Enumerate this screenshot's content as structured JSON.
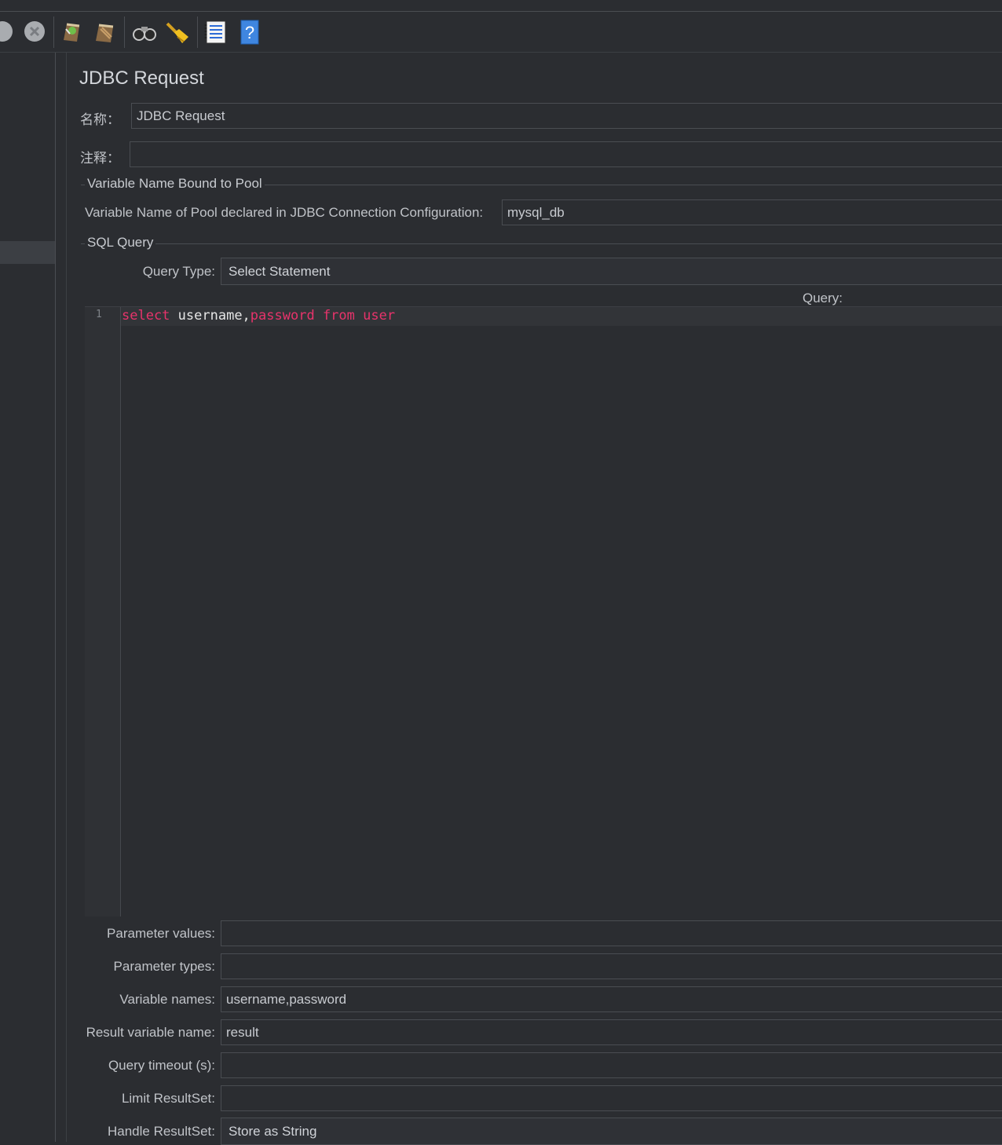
{
  "toolbar": {
    "icons": [
      "stop-icon",
      "shutdown-icon",
      "clear-icon",
      "clear-all-icon",
      "search-icon",
      "reset-search-icon",
      "function-helper-icon",
      "help-icon"
    ]
  },
  "panel": {
    "title": "JDBC Request",
    "name_label": "名称：",
    "name_value": "JDBC Request",
    "comment_label": "注释：",
    "comment_value": ""
  },
  "pool": {
    "group_title": "Variable Name Bound to Pool",
    "label": "Variable Name of Pool declared in JDBC Connection Configuration:",
    "value": "mysql_db"
  },
  "sql": {
    "group_title": "SQL Query",
    "query_type_label": "Query Type:",
    "query_type_value": "Select Statement",
    "query_label": "Query:",
    "line_number": "1",
    "code": {
      "kw1": "select",
      "ident": "username,",
      "kw2": "password",
      "kw3": "from",
      "kw4": "user"
    }
  },
  "params": {
    "parameter_values_label": "Parameter values:",
    "parameter_values": "",
    "parameter_types_label": "Parameter types:",
    "parameter_types": "",
    "variable_names_label": "Variable names:",
    "variable_names": "username,password",
    "result_variable_label": "Result variable name:",
    "result_variable": "result",
    "query_timeout_label": "Query timeout (s):",
    "query_timeout": "",
    "limit_resultset_label": "Limit ResultSet:",
    "limit_resultset": "",
    "handle_resultset_label": "Handle ResultSet:",
    "handle_resultset": "Store as String"
  },
  "colors": {
    "background": "#2b2d31",
    "keyword": "#e8336b",
    "text": "#c8cbd0"
  }
}
